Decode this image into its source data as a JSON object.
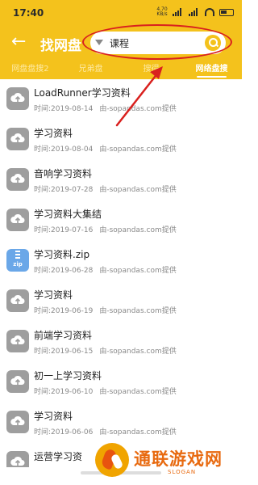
{
  "status_bar": {
    "time": "17:40",
    "network": "4.70 KB/s"
  },
  "header": {
    "title": "找网盘",
    "search_value": "课程"
  },
  "tabs": [
    {
      "label": "网盘盘搜2",
      "active": false
    },
    {
      "label": "兄弟盘",
      "active": false
    },
    {
      "label": "搜得",
      "active": false
    },
    {
      "label": "网络盘搜",
      "active": true
    }
  ],
  "items": [
    {
      "name": "LoadRunner学习资料",
      "time": "时间:2019-08-14",
      "source": "由-sopandas.com提供",
      "icon": "cloud-icon"
    },
    {
      "name": "学习资料",
      "time": "时间:2019-08-04",
      "source": "由-sopandas.com提供",
      "icon": "cloud-icon"
    },
    {
      "name": "音响学习资料",
      "time": "时间:2019-07-28",
      "source": "由-sopandas.com提供",
      "icon": "cloud-icon"
    },
    {
      "name": "学习资料大集结",
      "time": "时间:2019-07-16",
      "source": "由-sopandas.com提供",
      "icon": "cloud-icon"
    },
    {
      "name": "学习资料.zip",
      "time": "时间:2019-06-28",
      "source": "由-sopandas.com提供",
      "icon": "zip-icon"
    },
    {
      "name": "学习资料",
      "time": "时间:2019-06-19",
      "source": "由-sopandas.com提供",
      "icon": "cloud-icon"
    },
    {
      "name": "前端学习资料",
      "time": "时间:2019-06-15",
      "source": "由-sopandas.com提供",
      "icon": "cloud-icon"
    },
    {
      "name": "初一上学习资料",
      "time": "时间:2019-06-10",
      "source": "由-sopandas.com提供",
      "icon": "cloud-icon"
    },
    {
      "name": "学习资料",
      "time": "时间:2019-06-06",
      "source": "由-sopandas.com提供",
      "icon": "cloud-icon"
    },
    {
      "name": "运营学习资",
      "time": "",
      "source": "",
      "icon": "cloud-icon"
    }
  ],
  "watermark": {
    "text": "通联游戏网",
    "slogan": "SLOGAN"
  },
  "colors": {
    "brand_yellow": "#f4c21c",
    "annotation_red": "#d9201e",
    "watermark_orange": "#e86a10"
  }
}
